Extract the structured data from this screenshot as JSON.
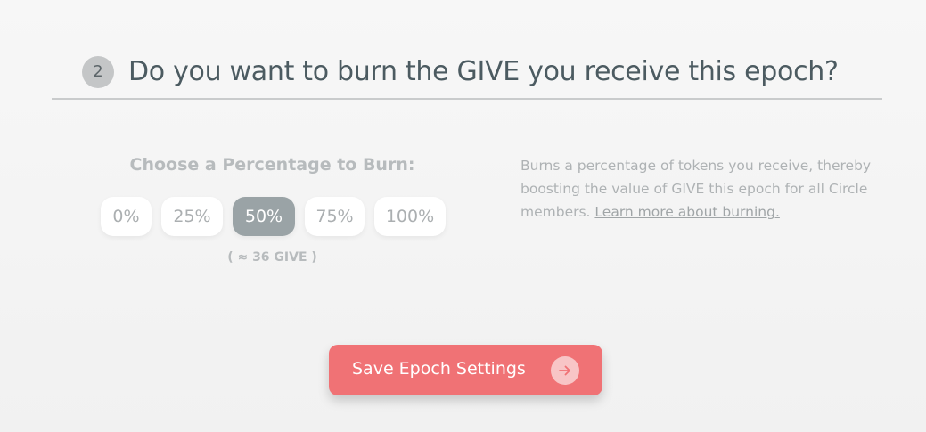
{
  "section": {
    "step_number": "2",
    "title": "Do you want to burn the GIVE you receive this epoch?"
  },
  "burn": {
    "choose_label": "Choose a Percentage to Burn:",
    "options": [
      {
        "label": "0%",
        "selected": false
      },
      {
        "label": "25%",
        "selected": false
      },
      {
        "label": "50%",
        "selected": true
      },
      {
        "label": "75%",
        "selected": false
      },
      {
        "label": "100%",
        "selected": false
      }
    ],
    "approx_give": "( ≈ 36 GIVE )"
  },
  "description": {
    "text": "Burns a percentage of tokens you receive, thereby boosting the value of GIVE this epoch for all Circle members. ",
    "link_text": "Learn more about burning."
  },
  "save_button": {
    "label": "Save Epoch Settings",
    "icon": "arrow-right-icon"
  },
  "colors": {
    "accent": "#f07275",
    "selected_option": "#9aa3a6",
    "title_text": "#4c5b61"
  }
}
